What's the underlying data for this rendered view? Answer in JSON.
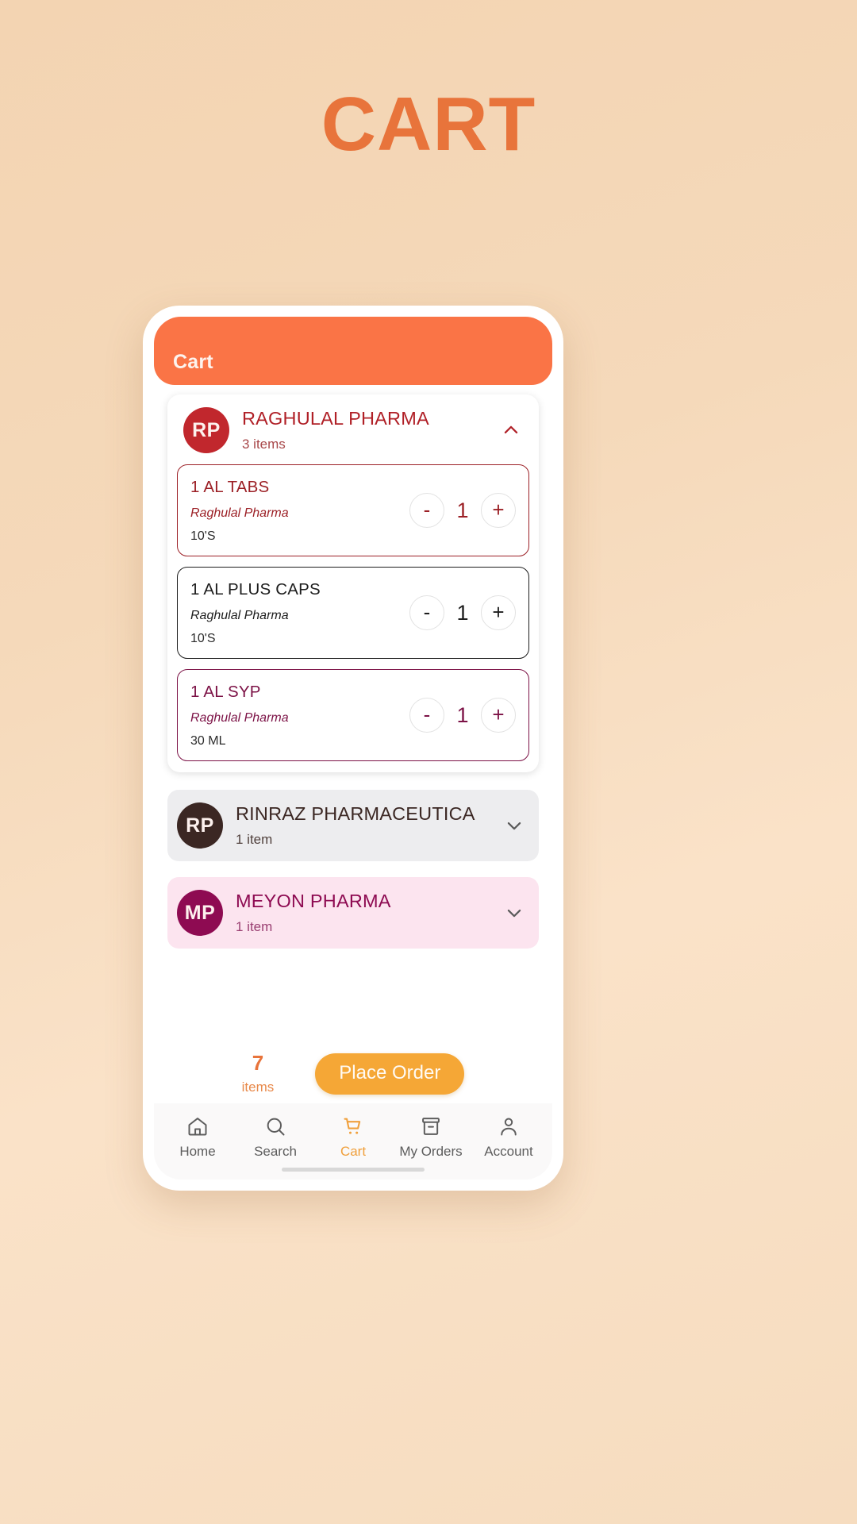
{
  "page": {
    "title": "CART"
  },
  "colors": {
    "accent_orange": "#e8743b",
    "appbar_orange": "#fa7446",
    "place_order_orange": "#f5a736",
    "raghulal_red": "#b02027",
    "rinraz_brown": "#3b2723",
    "meyon_magenta": "#8e0b52"
  },
  "appbar": {
    "title": "Cart"
  },
  "vendors": [
    {
      "initials": "RP",
      "name": "RAGHULAL PHARMA",
      "count_label": "3 items",
      "expanded": true,
      "chevron": "chevron-up-icon",
      "avatar_color": "#c1272d",
      "name_color": "#b02027",
      "count_color": "#a8484a",
      "card_bg": "#ffffff",
      "items": [
        {
          "name": "1 AL TABS",
          "vendor": "Raghulal Pharma",
          "pack": "10'S",
          "qty": "1",
          "minus": "-",
          "plus": "+",
          "border_color": "#9c2026",
          "text_color": "#9c2026"
        },
        {
          "name": "1 AL PLUS CAPS",
          "vendor": "Raghulal Pharma",
          "pack": "10'S",
          "qty": "1",
          "minus": "-",
          "plus": "+",
          "border_color": "#1d1d1d",
          "text_color": "#1d1d1d"
        },
        {
          "name": "1 AL SYP",
          "vendor": "Raghulal Pharma",
          "pack": "30 ML",
          "qty": "1",
          "minus": "-",
          "plus": "+",
          "border_color": "#7c1246",
          "text_color": "#7c1246"
        }
      ]
    },
    {
      "initials": "RP",
      "name": "RINRAZ PHARMACEUTICA",
      "count_label": "1 item",
      "expanded": false,
      "chevron": "chevron-down-icon",
      "avatar_color": "#3b2723",
      "name_color": "#3b2723",
      "count_color": "#50403c",
      "card_bg": "#ededef",
      "items": []
    },
    {
      "initials": "MP",
      "name": "MEYON PHARMA",
      "count_label": "1 item",
      "expanded": false,
      "chevron": "chevron-down-icon",
      "avatar_color": "#8e0b52",
      "name_color": "#8e0b52",
      "count_color": "#9a3f72",
      "card_bg": "#fce4ef",
      "items": []
    }
  ],
  "summary": {
    "count": "7",
    "count_label": "items",
    "place_order_label": "Place Order"
  },
  "nav": {
    "items": [
      {
        "label": "Home",
        "icon": "home-icon",
        "active": false
      },
      {
        "label": "Search",
        "icon": "search-icon",
        "active": false
      },
      {
        "label": "Cart",
        "icon": "cart-icon",
        "active": true
      },
      {
        "label": "My Orders",
        "icon": "orders-icon",
        "active": false
      },
      {
        "label": "Account",
        "icon": "account-icon",
        "active": false
      }
    ]
  }
}
